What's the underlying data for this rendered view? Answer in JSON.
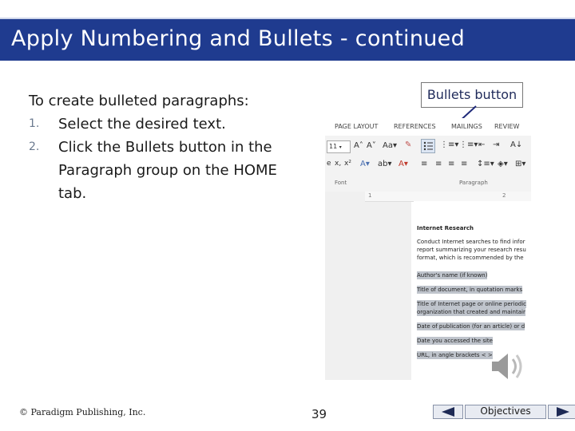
{
  "slide": {
    "title": "Apply Numbering and Bullets - continued",
    "intro": "To create bulleted paragraphs:",
    "steps": [
      {
        "num": "1.",
        "text": "Select the desired text."
      },
      {
        "num": "2.",
        "text": "Click the Bullets button in the Paragraph group on the HOME tab."
      }
    ],
    "callout": "Bullets button"
  },
  "screenshot": {
    "tabs": [
      "PAGE LAYOUT",
      "REFERENCES",
      "MAILINGS",
      "REVIEW"
    ],
    "font_size": "11",
    "groups": {
      "font": "Font",
      "paragraph": "Paragraph"
    },
    "ruler_marks": [
      "1",
      "2"
    ],
    "document": {
      "heading": "Internet Research",
      "paragraph": [
        "Conduct Internet searches to find infor",
        "report summarizing your research resu",
        "format, which is recommended by the"
      ],
      "highlighted_lines": [
        "Author's name (if known)",
        "Title of document, in quotation marks",
        "Title of Internet page or online periodic",
        "organization that created and maintair",
        "Date of publication (for an article) or d",
        "Date you accessed the site",
        "URL, in angle brackets < >"
      ]
    }
  },
  "footer": {
    "copyright": "© Paradigm Publishing, Inc.",
    "page_number": "39",
    "objectives_label": "Objectives"
  },
  "colors": {
    "title_bar": "#1f3b8f",
    "title_text": "#ffffff",
    "highlight": "#bfc4cc"
  }
}
